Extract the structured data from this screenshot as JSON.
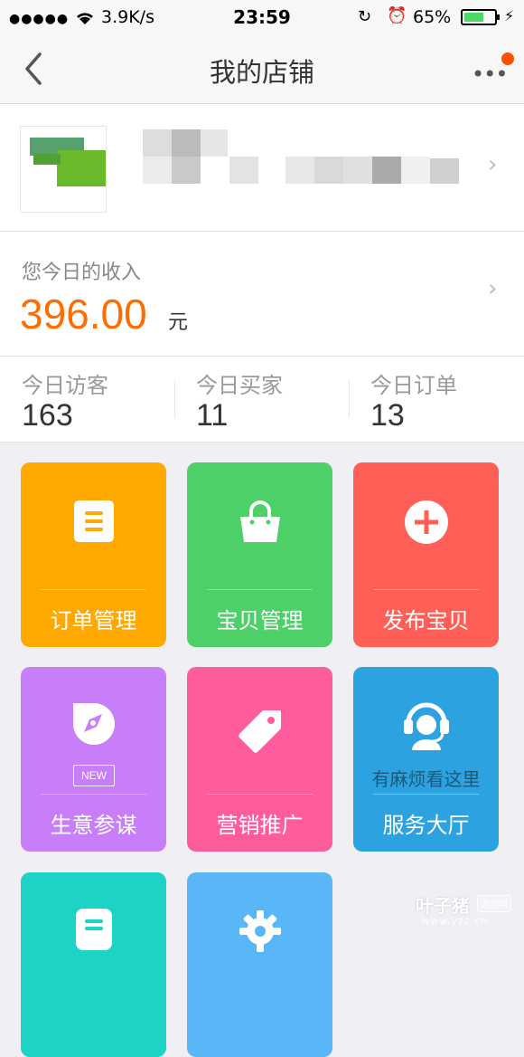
{
  "status_bar": {
    "signal": "●●●●●",
    "speed": "3.9K/s",
    "time": "23:59",
    "battery": "65%",
    "battery_level": 0.65
  },
  "nav": {
    "title": "我的店铺"
  },
  "income": {
    "label": "您今日的收入",
    "amount": "396.00",
    "unit": "元"
  },
  "stats": [
    {
      "label": "今日访客",
      "value": "163"
    },
    {
      "label": "今日买家",
      "value": "11"
    },
    {
      "label": "今日订单",
      "value": "13"
    }
  ],
  "tiles": [
    {
      "label": "订单管理",
      "color": "#ffa800",
      "icon": "order-list-icon"
    },
    {
      "label": "宝贝管理",
      "color": "#4cd067",
      "icon": "shopping-bag-icon"
    },
    {
      "label": "发布宝贝",
      "color": "#ff5f56",
      "icon": "plus-circle-icon"
    },
    {
      "label": "生意参谋",
      "color": "#c87ef8",
      "icon": "compass-icon",
      "badge": "NEW"
    },
    {
      "label": "营销推广",
      "color": "#ff5c9e",
      "icon": "price-tag-icon"
    },
    {
      "label": "服务大厅",
      "color": "#2da2e1",
      "icon": "customer-service-icon",
      "sub": "有麻烦看这里"
    },
    {
      "label": "",
      "color": "#1dd3c6",
      "icon": "document-icon"
    },
    {
      "label": "",
      "color": "#5ab7f7",
      "icon": "gear-icon"
    }
  ],
  "watermark": {
    "name": "叶子猪",
    "tag": "游戏网",
    "url": "www.yzz.cn"
  }
}
